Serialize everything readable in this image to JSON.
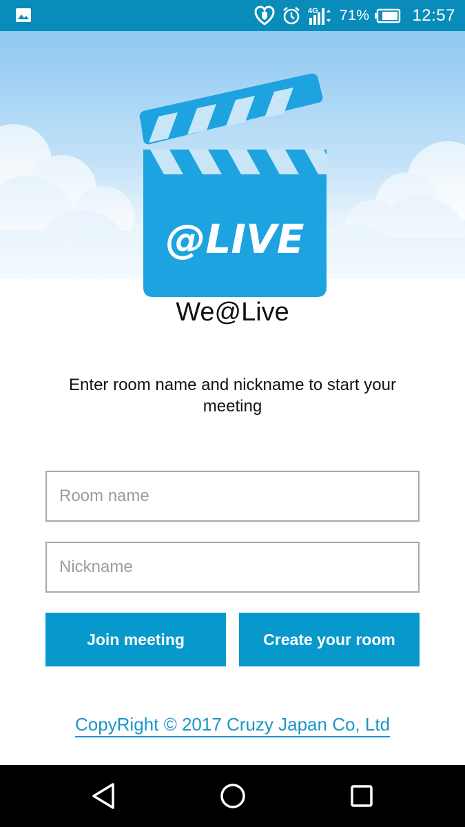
{
  "status_bar": {
    "network": "4G",
    "battery_percent": "71%",
    "time": "12:57",
    "icons": [
      "gallery-icon",
      "heart-shield-icon",
      "alarm-icon",
      "signal-icon",
      "battery-icon"
    ]
  },
  "logo": {
    "text": "@LIVE",
    "color": "#1ea3e1"
  },
  "app": {
    "name": "We@Live"
  },
  "form": {
    "instructions": "Enter room name and nickname to start your meeting",
    "room_placeholder": "Room name",
    "room_value": "",
    "nickname_placeholder": "Nickname",
    "nickname_value": "",
    "join_label": "Join meeting",
    "create_label": "Create your room"
  },
  "footer": {
    "copyright": "CopyRight © 2017 Cruzy Japan Co, Ltd"
  },
  "colors": {
    "status_bar": "#0a8cba",
    "button": "#0899cc",
    "link": "#1a95c9",
    "logo_blue": "#1ea3e1"
  },
  "nav_bar": {
    "icons": [
      "back-icon",
      "home-icon",
      "recent-apps-icon"
    ]
  }
}
